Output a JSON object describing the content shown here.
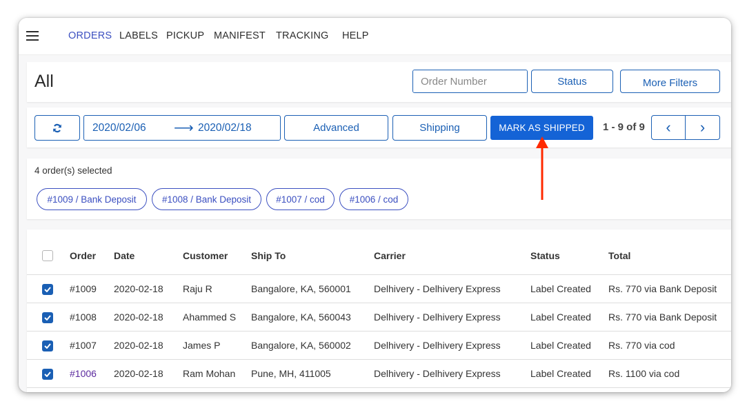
{
  "nav": {
    "items": [
      {
        "label": "ORDERS",
        "active": true
      },
      {
        "label": "LABELS",
        "active": false
      },
      {
        "label": "PICKUP",
        "active": false
      },
      {
        "label": "MANIFEST",
        "active": false
      },
      {
        "label": "TRACKING",
        "active": false
      },
      {
        "label": "HELP",
        "active": false
      }
    ]
  },
  "header": {
    "title": "All",
    "search_placeholder": "Order Number",
    "status_label": "Status",
    "more_filters_label": "More Filters"
  },
  "toolbar": {
    "date_from": "2020/02/06",
    "date_arrow": "⟶",
    "date_to": "2020/02/18",
    "advanced_label": "Advanced",
    "shipping_label": "Shipping",
    "mark_shipped_label": "MARK AS SHIPPED",
    "page_info": "1 - 9 of 9",
    "prev_label": "‹",
    "next_label": "›"
  },
  "selection": {
    "count_text": "4 order(s) selected",
    "chips": [
      "#1009 / Bank Deposit",
      "#1008 / Bank Deposit",
      "#1007 / cod",
      "#1006 / cod"
    ]
  },
  "table": {
    "columns": [
      "Order",
      "Date",
      "Customer",
      "Ship To",
      "Carrier",
      "Status",
      "Total"
    ],
    "rows": [
      {
        "order": "#1009",
        "date": "2020-02-18",
        "customer": "Raju R",
        "ship_to": "Bangalore, KA, 560001",
        "carrier": "Delhivery - Delhivery Express",
        "status": "Label Created",
        "total": "Rs. 770 via Bank Deposit",
        "checked": true
      },
      {
        "order": "#1008",
        "date": "2020-02-18",
        "customer": "Ahammed S",
        "ship_to": "Bangalore, KA, 560043",
        "carrier": "Delhivery - Delhivery Express",
        "status": "Label Created",
        "total": "Rs. 770 via Bank Deposit",
        "checked": true
      },
      {
        "order": "#1007",
        "date": "2020-02-18",
        "customer": "James P",
        "ship_to": "Bangalore, KA, 560002",
        "carrier": "Delhivery - Delhivery Express",
        "status": "Label Created",
        "total": "Rs. 770 via cod",
        "checked": true
      },
      {
        "order": "#1006",
        "date": "2020-02-18",
        "customer": "Ram Mohan",
        "ship_to": "Pune, MH, 411005",
        "carrier": "Delhivery - Delhivery Express",
        "status": "Label Created",
        "total": "Rs. 1100 via cod",
        "checked": true
      }
    ]
  },
  "colors": {
    "accent": "#1a5fb4",
    "primary_button": "#1463d6",
    "nav_active": "#3b4fc0",
    "annotation_arrow": "#ff2a00"
  }
}
